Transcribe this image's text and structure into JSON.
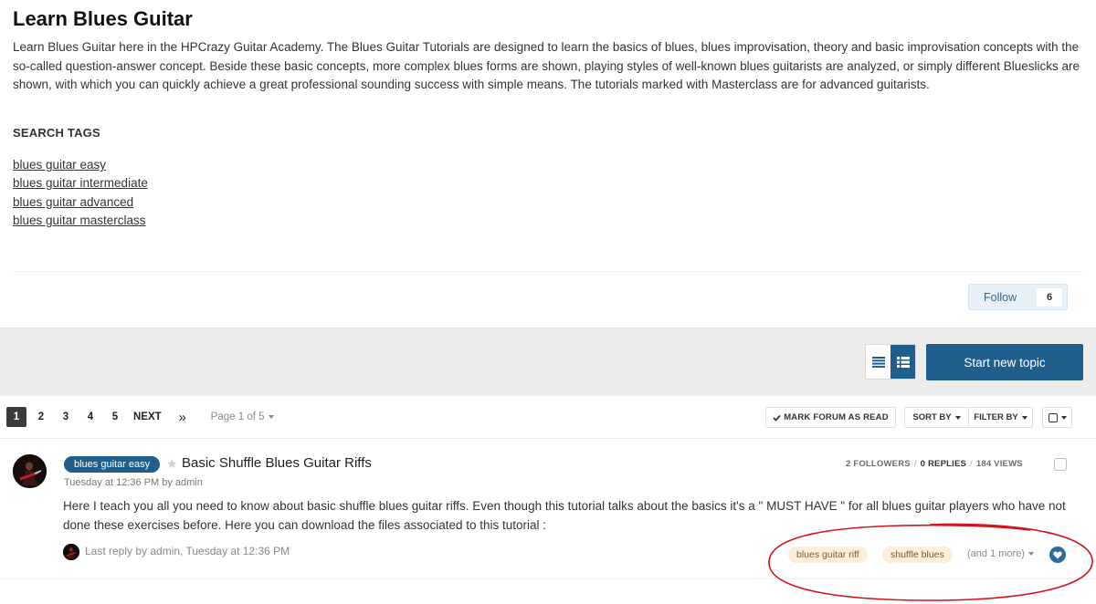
{
  "forum": {
    "title": "Learn Blues Guitar",
    "description": "Learn Blues Guitar here in the HPCrazy Guitar Academy. The Blues Guitar Tutorials are designed to learn the basics of blues, blues improvisation, theory and basic improvisation concepts with the so-called question-answer concept. Beside these basic concepts, more complex blues forms are shown, playing styles of well-known blues guitarists are analyzed, or simply different Blueslicks are shown, with which you can quickly achieve a great professional sounding success with simple means. The tutorials marked with Masterclass are for advanced guitarists.",
    "search_tags_heading": "SEARCH TAGS",
    "search_tags": [
      "blues guitar easy",
      "blues guitar intermediate",
      "blues guitar advanced",
      "blues guitar masterclass"
    ],
    "follow_label": "Follow",
    "follow_count": "6"
  },
  "toolbar": {
    "start_topic_label": "Start new topic",
    "view_modes": [
      "list-view-icon",
      "grid-view-icon"
    ],
    "active_view": "grid-view-icon"
  },
  "pagination": {
    "pages": [
      "1",
      "2",
      "3",
      "4",
      "5"
    ],
    "current": "1",
    "next_label": "NEXT",
    "last_label": "»",
    "page_of": "Page 1 of 5"
  },
  "actions": {
    "mark_read": "MARK FORUM AS READ",
    "sort_by": "SORT BY",
    "filter_by": "FILTER BY"
  },
  "topic": {
    "prefix": "blues guitar easy",
    "title": "Basic Shuffle Blues Guitar Riffs",
    "meta": "Tuesday at 12:36 PM by admin",
    "followers": "2 FOLLOWERS",
    "replies": "0 REPLIES",
    "views": "184 VIEWS",
    "snippet": "Here I teach you all you need to know about basic shuffle blues guitar riffs. Even though this tutorial talks about the basics it's a \" MUST HAVE \" for all blues guitar players who have not done these exercises before. Here you can download the files associated to this tutorial :",
    "last_reply": "Last reply by admin, Tuesday at 12:36 PM",
    "tags": [
      "blues guitar riff",
      "shuffle blues"
    ],
    "more_tags": "(and 1 more)"
  },
  "colors": {
    "brand": "#205e8c",
    "tag_bg": "#fcefd9",
    "annotation": "#d0141b"
  }
}
